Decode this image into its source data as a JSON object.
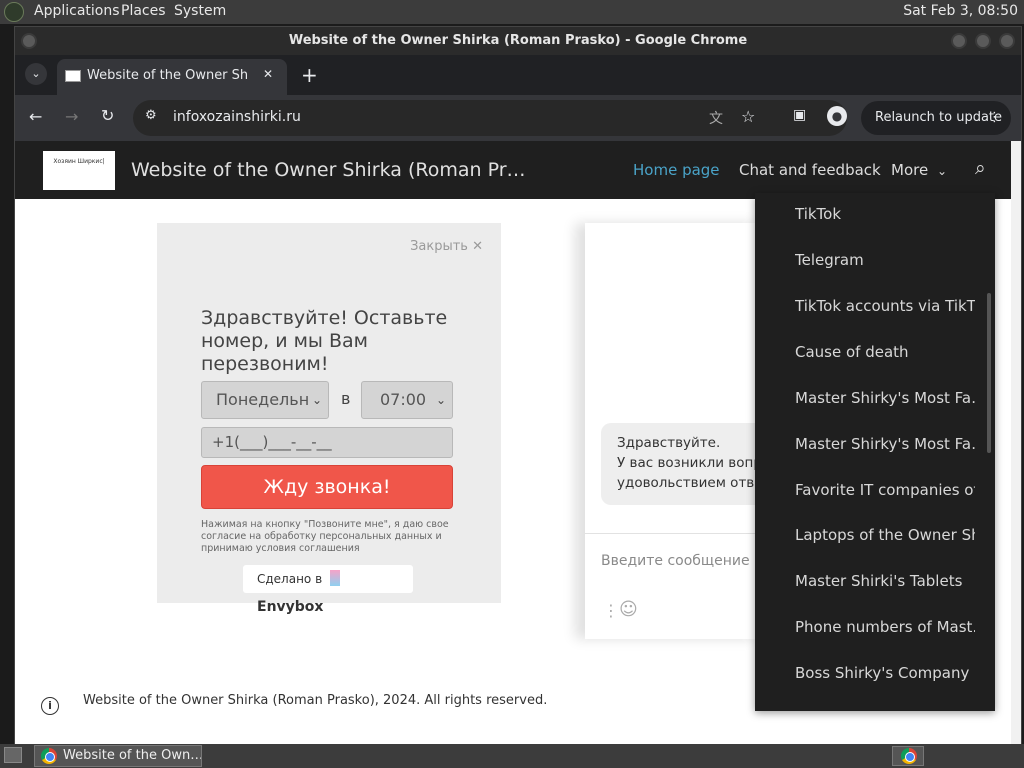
{
  "os_panel": {
    "menus": [
      "Applications",
      "Places",
      "System"
    ],
    "clock": "Sat Feb 3, 08:50"
  },
  "window": {
    "title": "Website of the Owner Shirka (Roman Prasko) - Google Chrome"
  },
  "tabbar": {
    "tab_title": "Website of the Owner Shirka",
    "tab_close": "✕",
    "new_tab": "+"
  },
  "toolbar": {
    "url": "infoxozainshirki.ru",
    "relaunch_label": "Relaunch to update"
  },
  "site": {
    "logo_text": "Хозяин Ширкис|",
    "title": "Website of the Owner Shirka (Roman Pr…",
    "nav": {
      "home": "Home page",
      "chat": "Chat and feedback",
      "more": "More"
    },
    "colors": {
      "home_active": "#4aa3c8"
    }
  },
  "popup": {
    "close_label": "Закрыть ✕",
    "greeting": "Здравствуйте! Оставьте номер, и мы Вам перезвоним!",
    "day_select": "Понедельн",
    "in_label": "в",
    "time_select": "07:00",
    "phone_value": "+1(___)___-__-__",
    "call_button": "Жду звонка!",
    "consent": "Нажимая на кнопку \"Позвоните мне\", я даю свое согласие на обработку персональных данных и принимаю условия соглашения",
    "made_in": "Сделано в",
    "brand": "Envybox"
  },
  "chat": {
    "bubble_line1": "Здравствуйте.",
    "bubble_line2": "У вас возникли вопр",
    "bubble_line3": "удовольствием отве",
    "input_placeholder": "Введите сообщение"
  },
  "footer": {
    "text": "Website of the Owner Shirka (Roman Prasko), 2024. All rights reserved."
  },
  "dropdown": {
    "items": [
      "TikTok",
      "Telegram",
      "TikTok accounts via TikT…",
      "Cause of death",
      "Master Shirky's Most Fa…",
      "Master Shirky's Most Fa…",
      "Favorite IT companies of…",
      "Laptops of the Owner Sh…",
      "Master Shirki's Tablets",
      "Phone numbers of Mast…",
      "Boss Shirky's Company"
    ]
  },
  "taskbar": {
    "item_label": "Website of the Own…"
  }
}
